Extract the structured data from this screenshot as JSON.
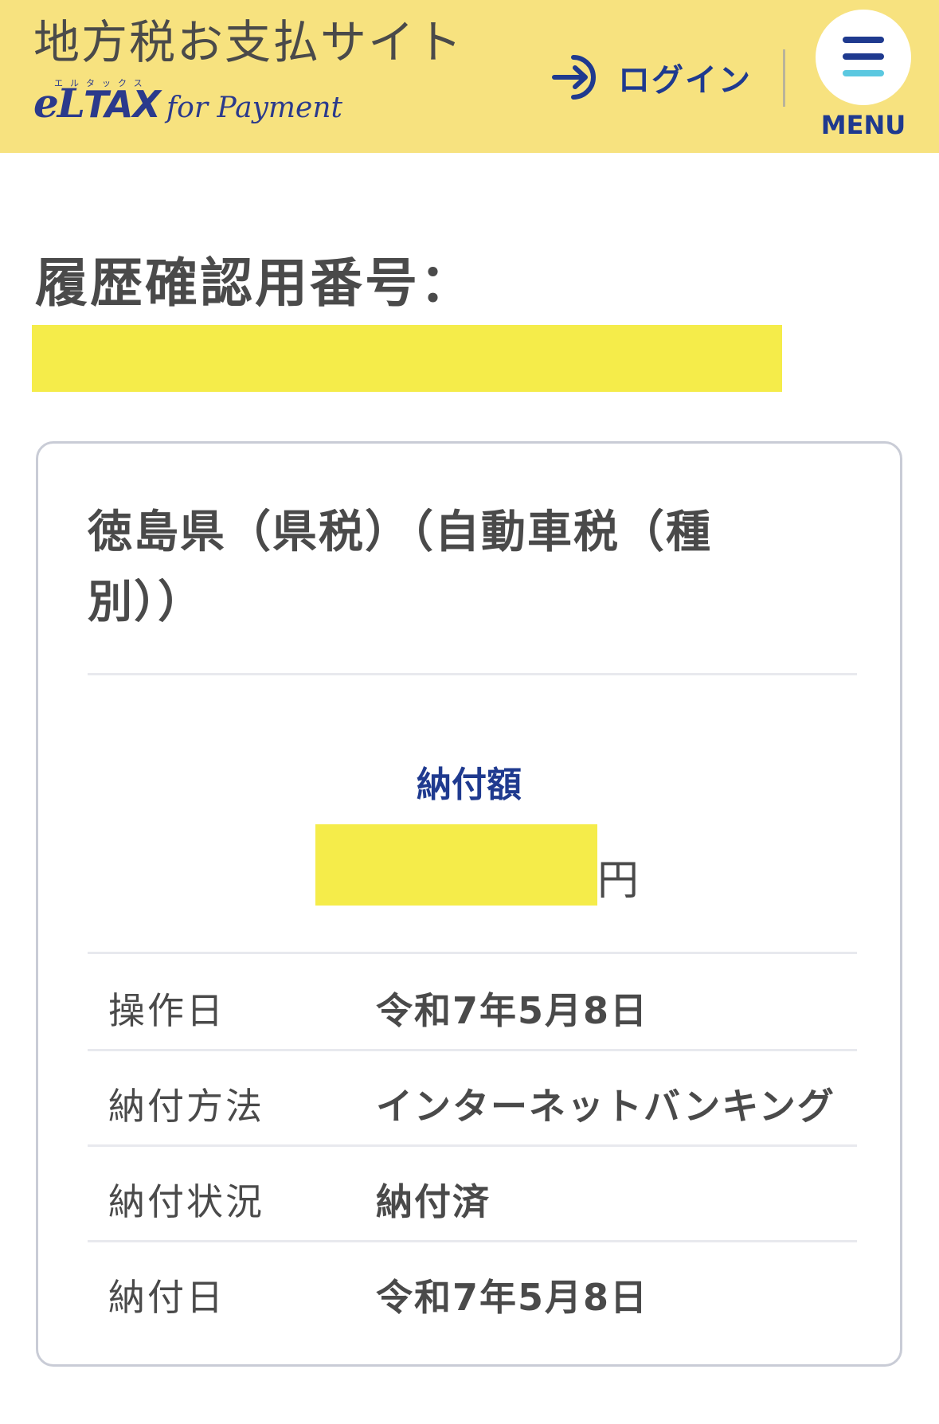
{
  "header": {
    "site_title": "地方税お支払サイト",
    "logo": {
      "el": "eL",
      "tax": "TAX",
      "kana": "エルタックス",
      "for_payment": "for Payment"
    },
    "login": {
      "label": "ログイン",
      "icon": "login-arrow-icon"
    },
    "menu": {
      "label": "MENU",
      "icon": "hamburger-menu-icon"
    },
    "colors": {
      "background": "#f7e27f",
      "accent": "#1f3a8f",
      "menu_bar_light": "#5bc8e0"
    }
  },
  "main": {
    "heading": "履歴確認用番号：",
    "card": {
      "title": "徳島県（県税）（自動車税（種別））",
      "amount_label": "納付額",
      "amount_unit": "円",
      "details": [
        {
          "label": "操作日",
          "value": "令和7年5月8日"
        },
        {
          "label": "納付方法",
          "value": "インターネットバンキング"
        },
        {
          "label": "納付状況",
          "value": "納付済"
        },
        {
          "label": "納付日",
          "value": "令和7年5月8日"
        }
      ]
    },
    "redaction_color": "#f5ec4a"
  }
}
